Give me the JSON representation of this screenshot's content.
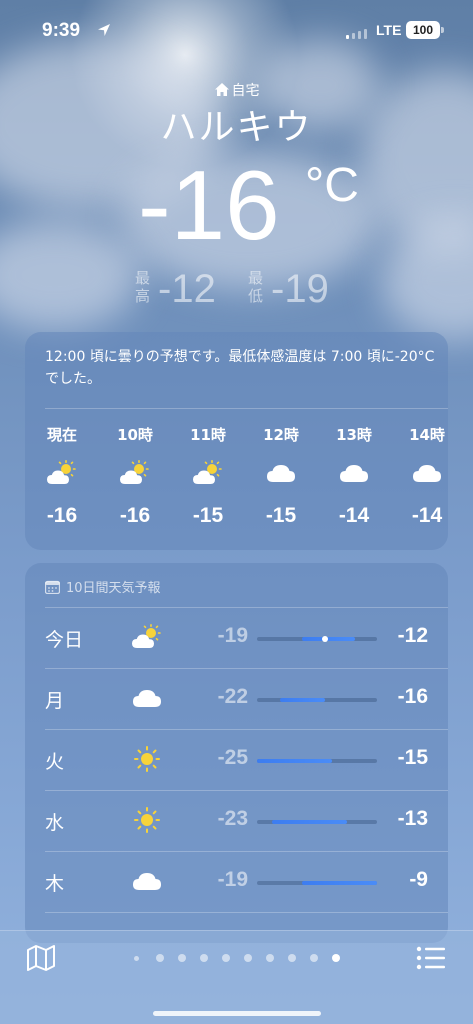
{
  "status_bar": {
    "time": "9:39",
    "network": "LTE",
    "battery": "100"
  },
  "location": {
    "home_label": "自宅",
    "city": "ハルキウ"
  },
  "current": {
    "temperature": "-16",
    "unit": "°C",
    "high_label": "最高",
    "high": "-12",
    "low_label": "最低",
    "low": "-19"
  },
  "hourly": {
    "summary": "12:00 頃に曇りの予想です。最低体感温度は 7:00 頃に-20°C でした。",
    "items": [
      {
        "label": "現在",
        "icon": "partly-cloudy-icon",
        "temp": "-16"
      },
      {
        "label": "10時",
        "icon": "partly-cloudy-icon",
        "temp": "-16"
      },
      {
        "label": "11時",
        "icon": "partly-cloudy-icon",
        "temp": "-15"
      },
      {
        "label": "12時",
        "icon": "cloud-icon",
        "temp": "-15"
      },
      {
        "label": "13時",
        "icon": "cloud-icon",
        "temp": "-14"
      },
      {
        "label": "14時",
        "icon": "cloud-icon",
        "temp": "-14"
      }
    ]
  },
  "daily": {
    "header": "10日間天気予報",
    "range": {
      "min": -25,
      "max": -9
    },
    "current_temp_value": -16,
    "items": [
      {
        "day": "今日",
        "icon": "partly-cloudy-icon",
        "low": "-19",
        "high": "-12",
        "low_value": -19,
        "high_value": -12,
        "show_current": true
      },
      {
        "day": "月",
        "icon": "cloud-icon",
        "low": "-22",
        "high": "-16",
        "low_value": -22,
        "high_value": -16,
        "show_current": false
      },
      {
        "day": "火",
        "icon": "sun-icon",
        "low": "-25",
        "high": "-15",
        "low_value": -25,
        "high_value": -15,
        "show_current": false
      },
      {
        "day": "水",
        "icon": "sun-icon",
        "low": "-23",
        "high": "-13",
        "low_value": -23,
        "high_value": -13,
        "show_current": false
      },
      {
        "day": "木",
        "icon": "cloud-icon",
        "low": "-19",
        "high": "-9",
        "low_value": -19,
        "high_value": -9,
        "show_current": false
      }
    ]
  },
  "page_dots": {
    "count": 10,
    "active_index": 9
  },
  "colors": {
    "accent_bar": "#3d7df0",
    "sun": "#f7d33a"
  }
}
